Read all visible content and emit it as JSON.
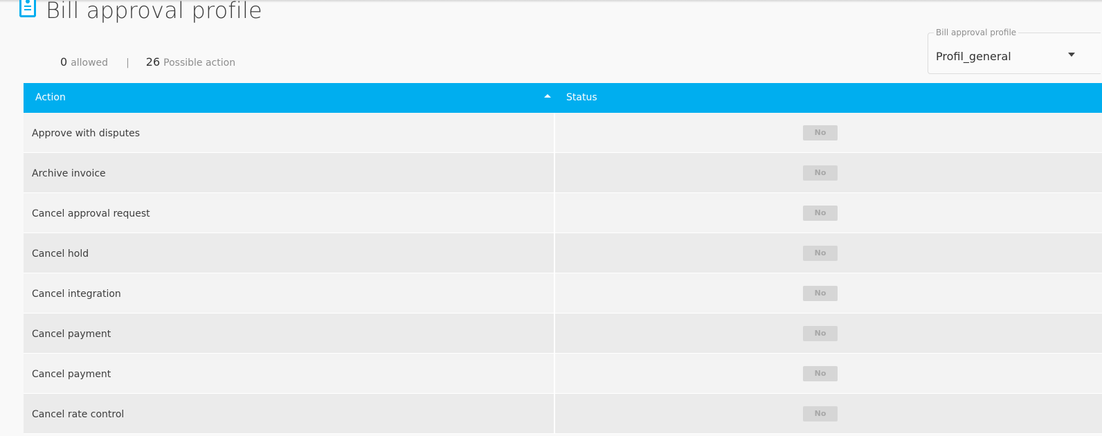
{
  "page": {
    "title": "Bill approval profile",
    "icon": "profile-card-icon",
    "accent": "#00aeef"
  },
  "summary": {
    "allowed_count": "0",
    "allowed_label": "allowed",
    "separator": "|",
    "possible_count": "26",
    "possible_label": "Possible action"
  },
  "profile_select": {
    "legend": "Bill approval profile",
    "value": "Profil_general"
  },
  "grid": {
    "columns": {
      "action": "Action",
      "status": "Status"
    },
    "sort": "ascending",
    "rows": [
      {
        "action": "Approve with disputes",
        "status": "No"
      },
      {
        "action": "Archive invoice",
        "status": "No"
      },
      {
        "action": "Cancel approval request",
        "status": "No"
      },
      {
        "action": "Cancel hold",
        "status": "No"
      },
      {
        "action": "Cancel integration",
        "status": "No"
      },
      {
        "action": "Cancel payment",
        "status": "No"
      },
      {
        "action": "Cancel payment",
        "status": "No"
      },
      {
        "action": "Cancel rate control",
        "status": "No"
      }
    ]
  }
}
